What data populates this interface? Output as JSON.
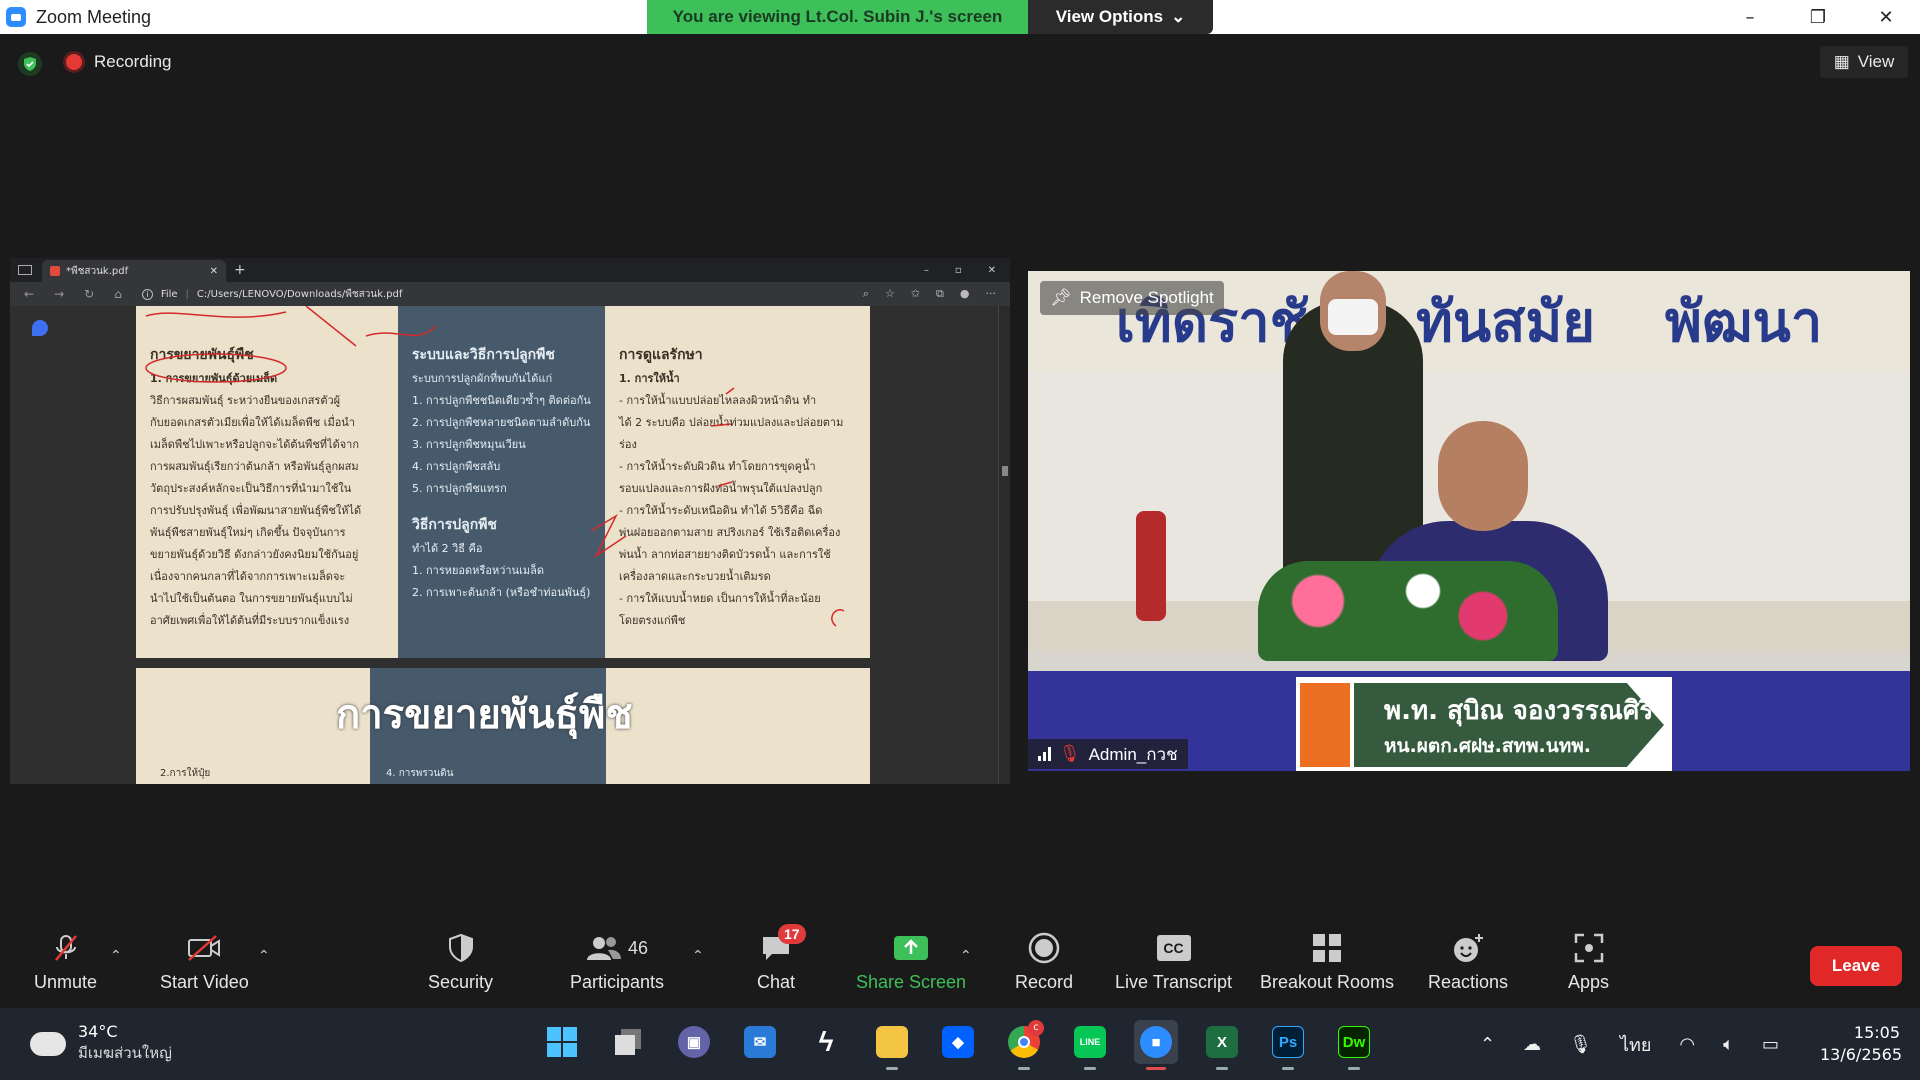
{
  "window": {
    "title": "Zoom Meeting",
    "controls": [
      "–",
      "❐",
      "✕"
    ]
  },
  "banner": {
    "viewing": "You are viewing Lt.Col. Subin J.'s screen",
    "view_options": "View Options"
  },
  "top": {
    "recording": "Recording",
    "view": "View"
  },
  "browser": {
    "tab_title": "*พืชสวนk.pdf",
    "url_prefix": "File",
    "url": "C:/Users/LENOVO/Downloads/พืชสวนk.pdf"
  },
  "slide1": {
    "col1_heading": "การขยายพันธุ์พืช",
    "col1_sub": "1. การขยายพันธุ์ด้วยเมล็ด",
    "col1_lines": [
      "วิธีการผสมพันธุ์ ระหว่างยีนของเกสรตัวผู้",
      "กับยอดเกสรตัวเมียเพื่อให้ได้เมล็ดพืช เมื่อนำ",
      "เมล็ดพืชไปเพาะหรือปลูกจะได้ต้นพืชที่ได้จาก",
      "การผสมพันธุ์เรียกว่าต้นกล้า หรือพันธุ์ลูกผสม",
      "วัตถุประสงค์หลักจะเป็นวิธีการที่นำมาใช้ใน",
      "การปรับปรุงพันธุ์ เพื่อพัฒนาสายพันธุ์พืชให้ได้",
      "พันธุ์พืชสายพันธุ์ใหม่ๆ เกิดขึ้น ปัจจุบันการ",
      "ขยายพันธุ์ด้วยวิธี ดังกล่าวยังคงนิยมใช้กันอยู่",
      "เนื่องจากคนกลาที่ได้จากการเพาะเมล็ดจะ",
      "นำไปใช้เป็นต้นตอ ในการขยายพันธุ์แบบไม่",
      "อาศัยเพศเพื่อให้ได้ต้นที่มีระบบรากแข็งแรง"
    ],
    "col2_heading": "ระบบและวิธีการปลูกพืช",
    "col2_intro": "ระบบการปลูกผักที่พบกันได้แก่",
    "col2_list": [
      "1. การปลูกพืชชนิดเดียวซ้ำๆ ติดต่อกัน",
      "2. การปลูกพืชหลายชนิดตามลำดับกัน",
      "3. การปลูกพืชหมุนเวียน",
      "4. การปลูกพืชสลับ",
      "5. การปลูกพืชแทรก"
    ],
    "col2_heading2": "วิธีการปลูกพืช",
    "col2_intro2": "ทำได้ 2 วิธี คือ",
    "col2_list2": [
      "1. การหยอดหรือหว่านเมล็ด",
      "2. การเพาะต้นกล้า (หรือชำท่อนพันธุ์)"
    ],
    "col3_heading": "การดูแลรักษา",
    "col3_sub": "1. การให้น้ำ",
    "col3_lines": [
      "- การให้น้ำแบบปล่อยไหลลงผิวหน้าดิน ทำ",
      "ได้ 2 ระบบคือ ปล่อยน้ำท่วมแปลงและปล่อยตาม",
      "ร่อง",
      "- การให้น้ำระดับผิวดิน ทำโดยการขุดคูน้ำ",
      "รอบแปลงและการฝังท่อน้ำพรุนใต้แปลงปลูก",
      "- การให้น้ำระดับเหนือดิน ทำได้ 5วิธีคือ ฉีด",
      "พ่นฝอยออกตามสาย สปริงเกอร์ ใช้เรือติดเครื่อง",
      "พ่นน้ำ ลากท่อสายยางติดบัวรดน้ำ และการใช้",
      "เครื่องลาดและกระบวยน้ำเติมรด",
      "- การให้แบบน้ำหยด เป็นการให้น้ำที่ละน้อย",
      "โดยตรงแก่พืช"
    ]
  },
  "slide2": {
    "title": "การขยายพันธุ์พืช",
    "peek_left": "2.การให้ปุ๋ย",
    "peek_mid": "4. การพรวนดิน"
  },
  "video": {
    "banner_words": [
      "เทิดราชัน",
      "ทันสมัย",
      "พัฒนา"
    ],
    "remove_spotlight": "Remove Spotlight",
    "participant_name": "Admin_กวช",
    "nameplate_line1": "พ.ท. สุบิณ จองวรรณศิริ",
    "nameplate_line2": "หน.ผตก.ศฝษ.สทพ.นทพ."
  },
  "toolbar": {
    "unmute": "Unmute",
    "start_video": "Start Video",
    "security": "Security",
    "participants": "Participants",
    "participants_count": "46",
    "chat": "Chat",
    "chat_badge": "17",
    "share_screen": "Share Screen",
    "record": "Record",
    "live_transcript": "Live Transcript",
    "cc": "CC",
    "breakout_rooms": "Breakout Rooms",
    "reactions": "Reactions",
    "apps": "Apps",
    "leave": "Leave"
  },
  "taskbar": {
    "temperature": "34°C",
    "weather_desc": "มีเมฆส่วนใหญ่",
    "language": "ไทย",
    "time": "15:05",
    "date": "13/6/2565",
    "chrome_badge": "c",
    "excel_label": "X",
    "ps_label": "Ps",
    "dw_label": "Dw",
    "line_label": "LINE"
  },
  "colors": {
    "accent_green": "#3dbf5a",
    "leave_red": "#e02828",
    "zoom_blue": "#2d8cff"
  }
}
